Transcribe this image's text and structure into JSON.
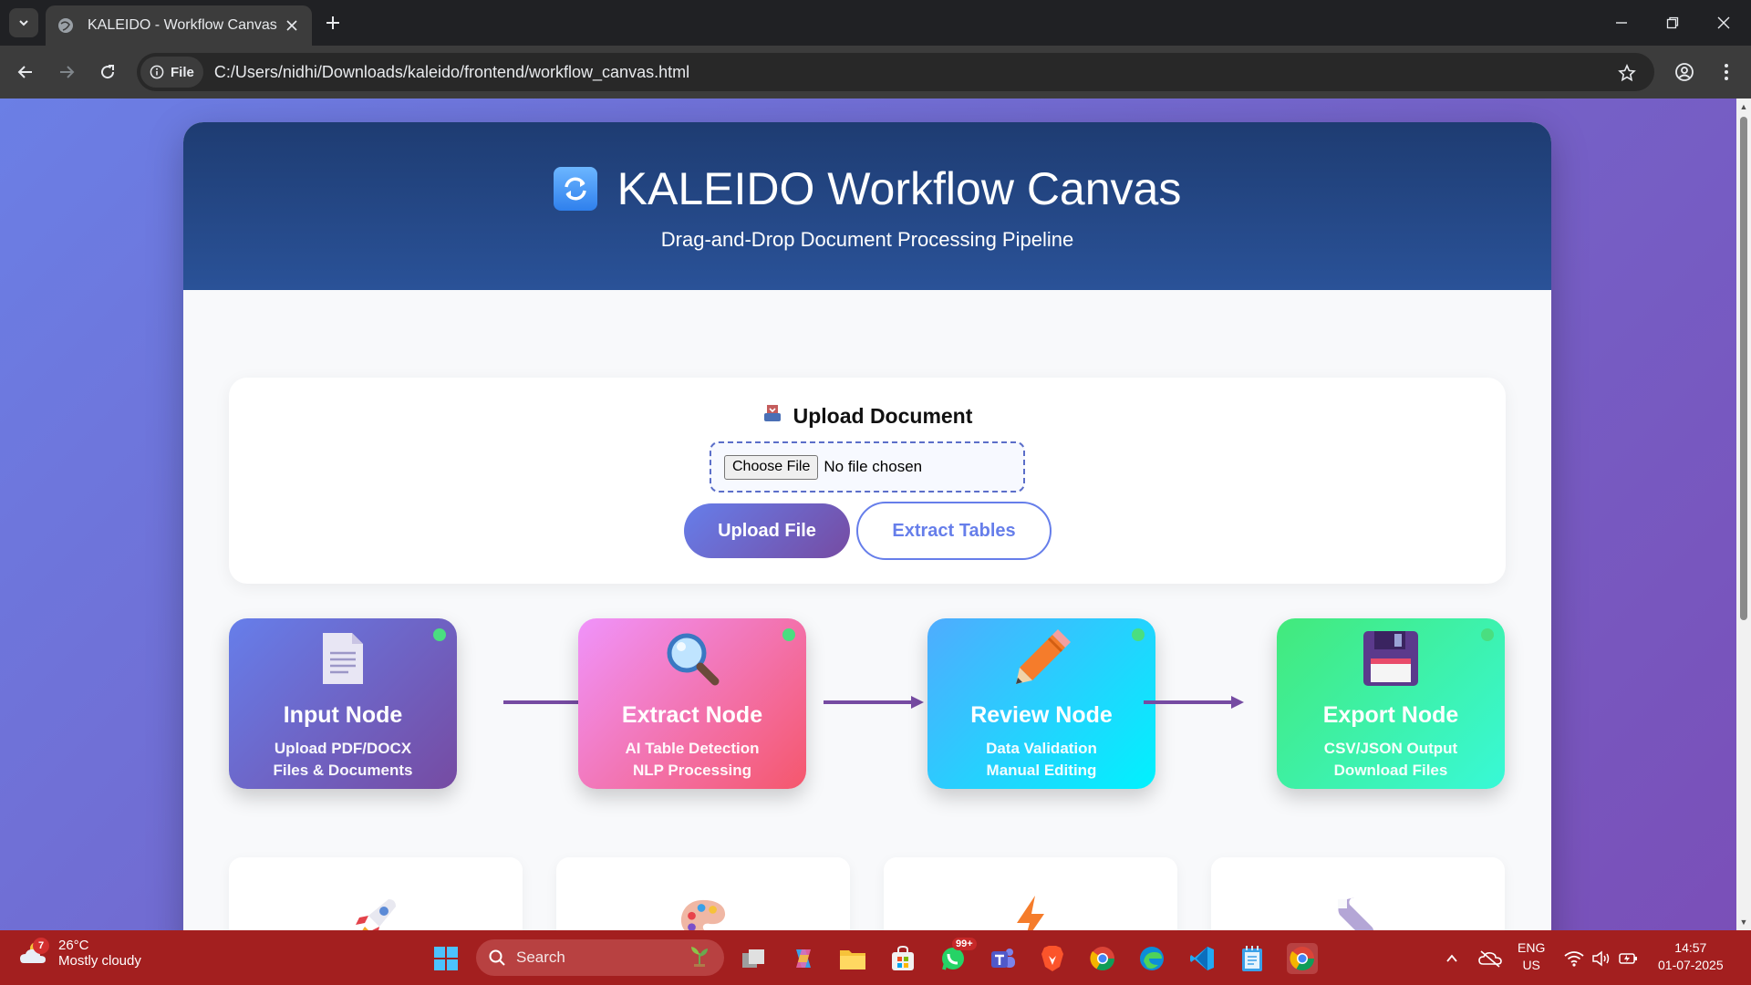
{
  "browser": {
    "tab_title": "KALEIDO - Workflow Canvas",
    "chip_label": "File",
    "url": "C:/Users/nidhi/Downloads/kaleido/frontend/workflow_canvas.html"
  },
  "header": {
    "title": "KALEIDO Workflow Canvas",
    "subtitle": "Drag-and-Drop Document Processing Pipeline"
  },
  "upload": {
    "heading": "Upload Document",
    "choose_label": "Choose File",
    "file_status": "No file chosen",
    "upload_button": "Upload File",
    "extract_button": "Extract Tables"
  },
  "nodes": [
    {
      "title": "Input Node",
      "line1": "Upload PDF/DOCX",
      "line2": "Files & Documents",
      "icon": "document-icon"
    },
    {
      "title": "Extract Node",
      "line1": "AI Table Detection",
      "line2": "NLP Processing",
      "icon": "magnifier-icon"
    },
    {
      "title": "Review Node",
      "line1": "Data Validation",
      "line2": "Manual Editing",
      "icon": "pencil-icon"
    },
    {
      "title": "Export Node",
      "line1": "CSV/JSON Output",
      "line2": "Download Files",
      "icon": "floppy-disk-icon"
    }
  ],
  "features": [
    {
      "icon": "rocket-icon"
    },
    {
      "icon": "palette-icon"
    },
    {
      "icon": "lightning-icon"
    },
    {
      "icon": "wrench-icon"
    }
  ],
  "colors": {
    "accent": "#667eea",
    "accent_dark": "#764ba2",
    "header_dark": "#1e3c72",
    "status_dot": "#4ade80"
  },
  "taskbar": {
    "temperature": "26°C",
    "weather": "Mostly cloudy",
    "weather_badge": "7",
    "search_label": "Search",
    "whatsapp_badge": "99+",
    "lang_line1": "ENG",
    "lang_line2": "US",
    "time": "14:57",
    "date": "01-07-2025"
  }
}
